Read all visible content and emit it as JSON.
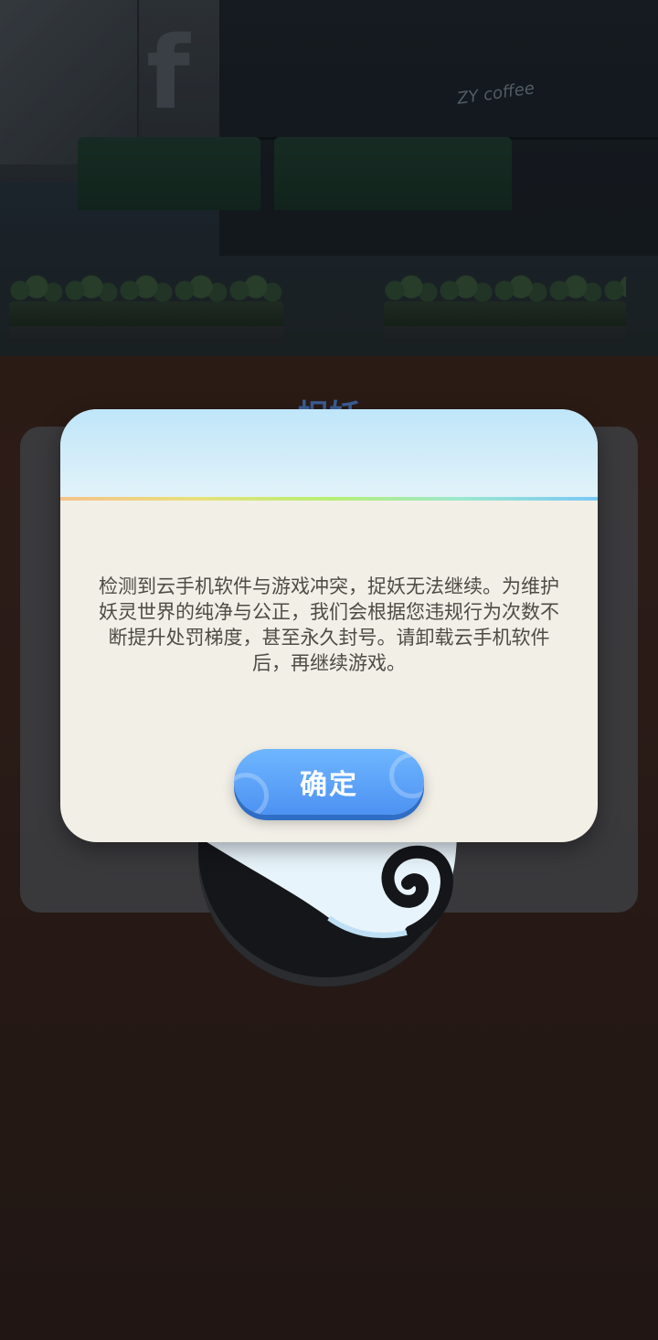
{
  "background": {
    "shop_sign": "ZY coffee",
    "building_letter": "f"
  },
  "back_panel": {
    "title": "捉妖"
  },
  "dialog": {
    "message": "检测到云手机软件与游戏冲突，捉妖无法继续。为维护妖灵世界的纯净与公正，我们会根据您违规行为次数不断提升处罚梯度，甚至永久封号。请卸载云手机软件后，再继续游戏。",
    "confirm_label": "确定"
  },
  "colors": {
    "dialog_bg": "#f2efe7",
    "header_bg": "#bfe6f9",
    "button_bg": "#5aa3f8",
    "text": "#4f4b45"
  }
}
